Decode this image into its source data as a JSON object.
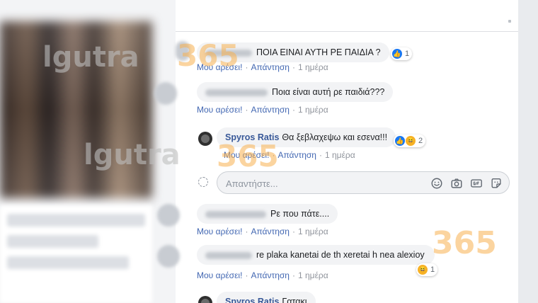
{
  "watermarks": {
    "brand_top": "lgutra",
    "number_top": "365",
    "brand_mid": "lgutra",
    "number_mid": "365",
    "number_bottom": "365"
  },
  "actions": {
    "like": "Μου αρέσει!",
    "reply": "Απάντηση",
    "separator": "·"
  },
  "comments": [
    {
      "text": "ΠΟΙΑ ΕΙΝΑΙ ΑΥΤΗ ΡΕ ΠΑΙΔΙΑ ?",
      "time": "1 ημέρα",
      "reaction_count": "1"
    },
    {
      "text": "Ποια είναι αυτή ρε παιδιά???",
      "time": "1 ημέρα"
    },
    {
      "author": "Spyros Ratis",
      "text": "Θα ξεβλαχεψω και εσενα!!!",
      "time": "1 ημέρα",
      "reaction_count": "2"
    },
    {
      "text": "Ρε που πάτε....",
      "time": "1 ημέρα"
    },
    {
      "text": "re plaka kanetai de th xeretai h nea alexioy",
      "time": "1 ημέρα",
      "reaction_count": "1"
    },
    {
      "author": "Spyros Ratis",
      "text": "Γατακι"
    }
  ],
  "composer": {
    "placeholder": "Απαντήστε...",
    "icons": [
      "emoji-icon",
      "camera-icon",
      "gif-icon",
      "sticker-icon"
    ]
  },
  "colors": {
    "link_blue": "#4267b2",
    "author_blue": "#385898",
    "bubble_gray": "#f2f3f5",
    "like_blue": "#1877f2",
    "haha_yellow": "#f7b125"
  }
}
